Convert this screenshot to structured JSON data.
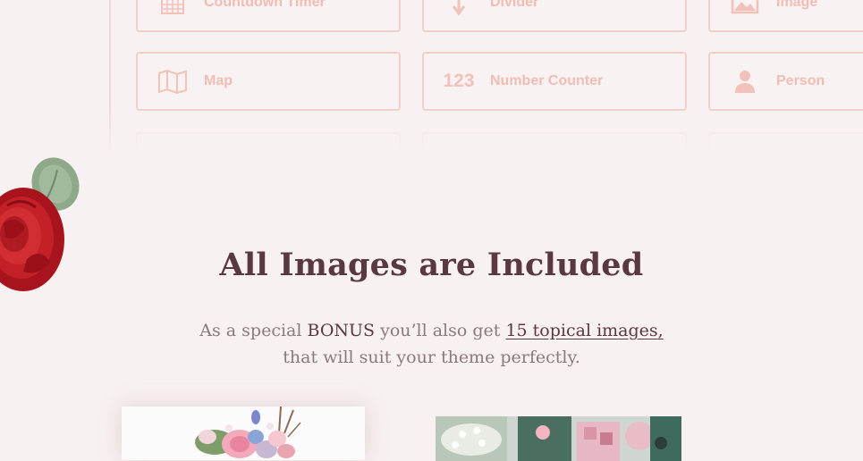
{
  "widgets": [
    {
      "label": "Countdown Timer",
      "icon": "calendar-icon"
    },
    {
      "label": "Divider",
      "icon": "arrow-down-icon"
    },
    {
      "label": "Image",
      "icon": "image-icon"
    },
    {
      "label": "Map",
      "icon": "map-icon"
    },
    {
      "label": "Number Counter",
      "icon": "number-counter-icon",
      "icon_text": "123"
    },
    {
      "label": "Person",
      "icon": "person-icon"
    }
  ],
  "section": {
    "heading": "All Images are Included",
    "sub_pre": "As a special ",
    "sub_bonus": "BONUS",
    "sub_mid": " you’ll also get ",
    "sub_link": "15 topical images",
    "sub_comma": ",",
    "sub_line2": "that will suit your theme perfectly."
  },
  "colors": {
    "background": "#f8f1f1",
    "card_border": "#f4cdc7",
    "heading": "#5a3840",
    "body_text": "#8a7a7e"
  }
}
